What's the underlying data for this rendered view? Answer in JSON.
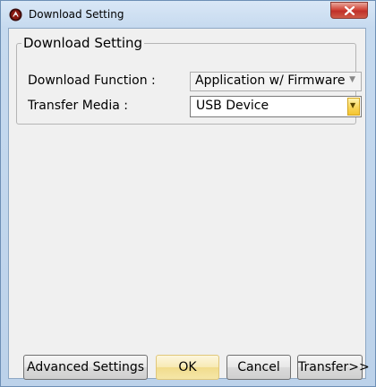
{
  "window": {
    "title": "Download Setting",
    "close_glyph": "x",
    "icon": "app-logo-icon"
  },
  "group": {
    "legend": "Download Setting",
    "download_function": {
      "label": "Download Function :",
      "value": "Application w/ Firmware",
      "enabled": false
    },
    "transfer_media": {
      "label": "Transfer Media :",
      "value": "USB Device",
      "enabled": true
    }
  },
  "buttons": {
    "advanced": "Advanced Settings",
    "ok": "OK",
    "cancel": "Cancel",
    "transfer": "Transfer>>"
  },
  "colors": {
    "title_bar": "#c6daef",
    "close_button": "#c0302a",
    "client_bg": "#f0f0f0",
    "ok_highlight": "#f7eab4",
    "dropdown_button": "#f9d65a"
  }
}
